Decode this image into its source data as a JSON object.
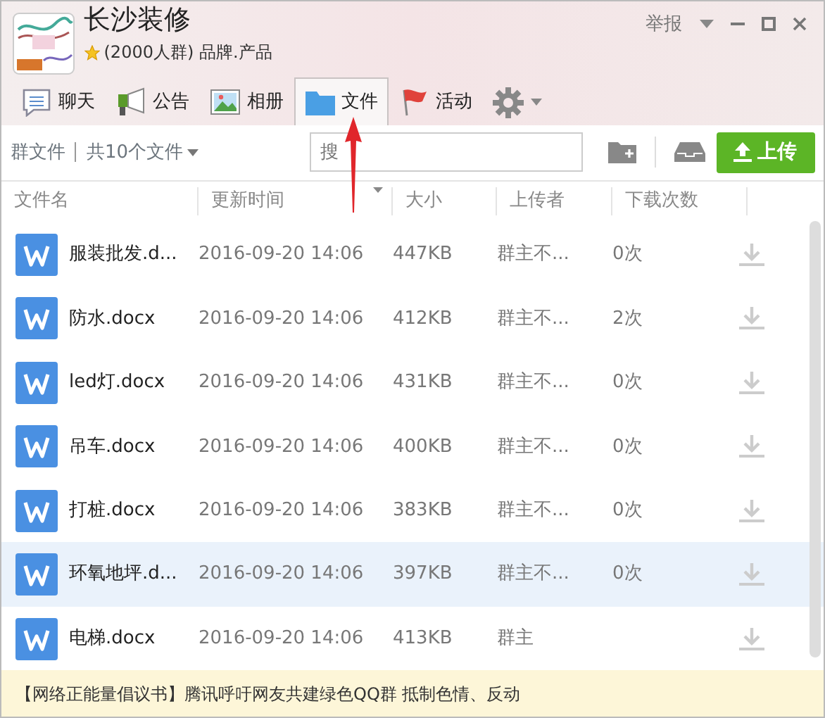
{
  "window": {
    "title": "长沙装修",
    "subtitle": "(2000人群) 品牌.产品",
    "report": "举报"
  },
  "tabs": [
    {
      "label": "聊天",
      "kind": "chat",
      "selected": false
    },
    {
      "label": "公告",
      "kind": "notice",
      "selected": false
    },
    {
      "label": "相册",
      "kind": "album",
      "selected": false
    },
    {
      "label": "文件",
      "kind": "files",
      "selected": true
    },
    {
      "label": "活动",
      "kind": "event",
      "selected": false
    }
  ],
  "toolbar": {
    "section": "群文件",
    "count": "共10个文件",
    "search_placeholder": "搜",
    "upload": "上传"
  },
  "table": {
    "columns": [
      "文件名",
      "更新时间",
      "大小",
      "上传者",
      "下载次数"
    ],
    "rows": [
      {
        "name": "服装批发.d...",
        "time": "2016-09-20 14:06",
        "size": "447KB",
        "uploader": "群主不...",
        "downloads": "0次",
        "selected": false
      },
      {
        "name": "防水.docx",
        "time": "2016-09-20 14:06",
        "size": "412KB",
        "uploader": "群主不...",
        "downloads": "2次",
        "selected": false
      },
      {
        "name": "led灯.docx",
        "time": "2016-09-20 14:06",
        "size": "431KB",
        "uploader": "群主不...",
        "downloads": "0次",
        "selected": false
      },
      {
        "name": "吊车.docx",
        "time": "2016-09-20 14:06",
        "size": "400KB",
        "uploader": "群主不...",
        "downloads": "0次",
        "selected": false
      },
      {
        "name": "打桩.docx",
        "time": "2016-09-20 14:06",
        "size": "383KB",
        "uploader": "群主不...",
        "downloads": "0次",
        "selected": false
      },
      {
        "name": "环氧地坪.d...",
        "time": "2016-09-20 14:06",
        "size": "397KB",
        "uploader": "群主不...",
        "downloads": "0次",
        "selected": true
      },
      {
        "name": "电梯.docx",
        "time": "2016-09-20 14:06",
        "size": "413KB",
        "uploader": "群主",
        "selected": false
      }
    ]
  },
  "notice": "【网络正能量倡议书】腾讯呼吁网友共建绿色QQ群 抵制色情、反动"
}
